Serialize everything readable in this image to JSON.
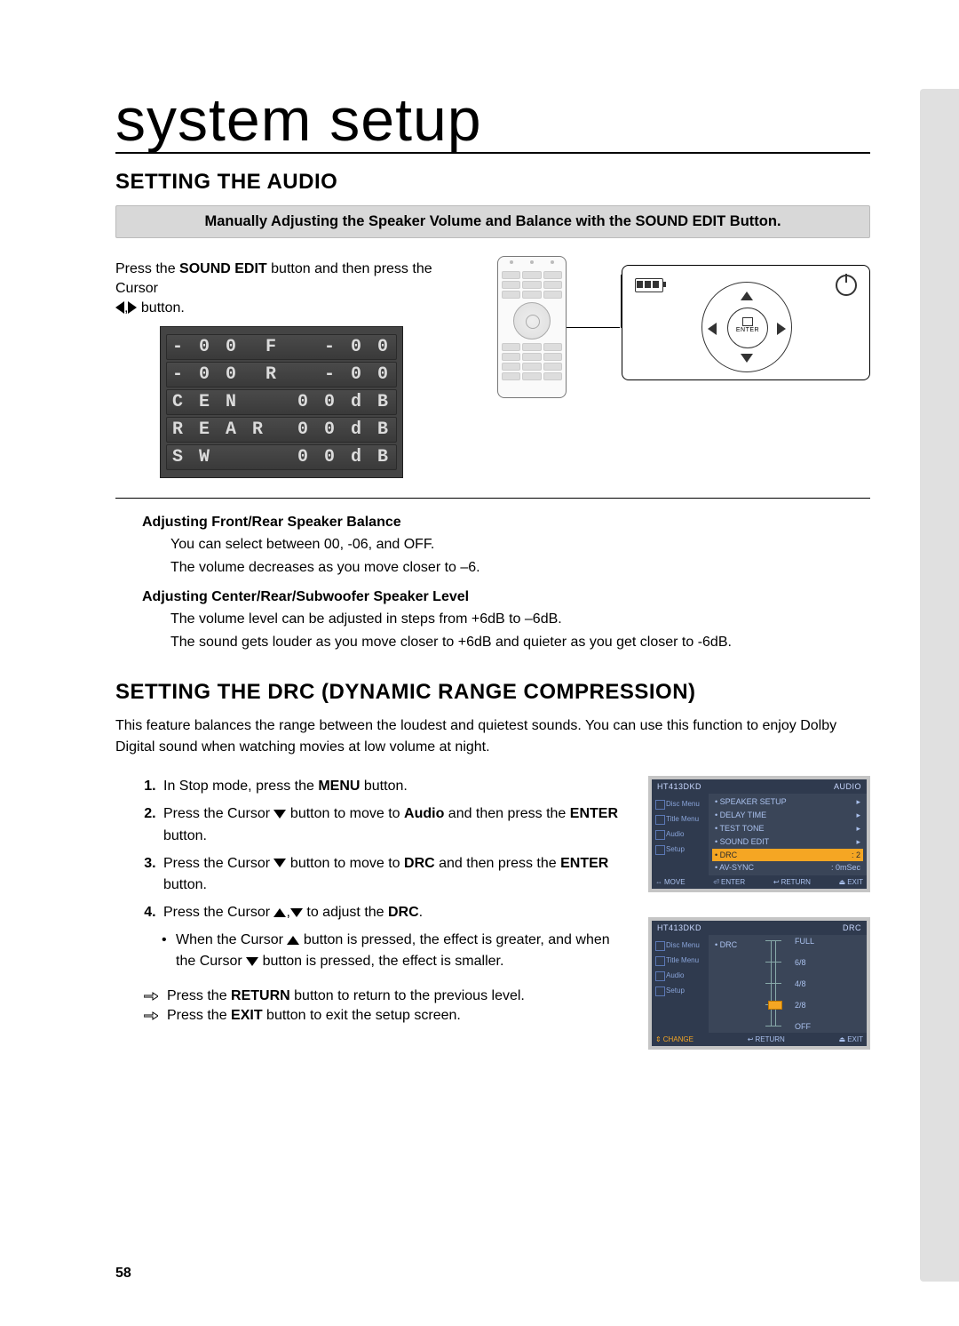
{
  "page_title": "system setup",
  "section1": {
    "heading": "SETTING THE AUDIO",
    "banner": "Manually Adjusting the Speaker Volume and Balance with the SOUND EDIT Button.",
    "intro_pre": "Press the ",
    "intro_bold": "SOUND EDIT",
    "intro_post": " button and then press the Cursor ",
    "intro_tail": " button.",
    "enter_label": "ENTER",
    "lcd_rows": [
      {
        "left": "- 0 0  F",
        "right": "- 0 0"
      },
      {
        "left": "- 0 0  R",
        "right": "- 0 0"
      },
      {
        "left": "C E N",
        "right": "0 0 d B"
      },
      {
        "left": "R E A R",
        "right": "0 0 d B"
      },
      {
        "left": "S W",
        "right": "0 0 d B"
      }
    ],
    "sub1_title": "Adjusting Front/Rear Speaker Balance",
    "sub1_line1": "You can select between 00, -06, and OFF.",
    "sub1_line2": "The volume decreases as you move closer to –6.",
    "sub2_title": "Adjusting Center/Rear/Subwoofer Speaker Level",
    "sub2_line1": "The volume level can be adjusted in steps from +6dB to –6dB.",
    "sub2_line2": "The sound gets louder as you move closer to +6dB and quieter as you get closer to -6dB."
  },
  "section2": {
    "heading": "SETTING THE DRC (DYNAMIC RANGE COMPRESSION)",
    "intro": "This feature balances the range between the loudest and quietest sounds. You can use this function to enjoy Dolby Digital sound when watching movies at low volume at night.",
    "step1_pre": "In Stop mode, press the ",
    "step1_bold": "MENU",
    "step1_post": " button.",
    "step2_a": "Press the Cursor ",
    "step2_b": " button to move to ",
    "step2_bold1": "Audio",
    "step2_c": " and then press the ",
    "step2_bold2": "ENTER",
    "step2_d": " button.",
    "step3_a": "Press the Cursor ",
    "step3_b": " button to move to ",
    "step3_bold1": "DRC",
    "step3_c": " and then press the ",
    "step3_bold2": "ENTER",
    "step3_d": " button.",
    "step4_a": "Press the Cursor ",
    "step4_b": " to adjust the ",
    "step4_bold": "DRC",
    "step4_c": ".",
    "bullet_a": "When the Cursor ",
    "bullet_b": " button is pressed, the effect is greater, and when the Cursor ",
    "bullet_c": " button is pressed, the effect is smaller.",
    "note1_a": "Press the ",
    "note1_bold": "RETURN",
    "note1_b": " button to return to the previous level.",
    "note2_a": "Press the ",
    "note2_bold": "EXIT",
    "note2_b": " button to exit the setup screen."
  },
  "osd1": {
    "breadcrumb": "HT413DKD",
    "tab": "AUDIO",
    "side": [
      "Disc Menu",
      "Title Menu",
      "Audio",
      "Setup"
    ],
    "items": [
      {
        "label": "SPEAKER SETUP",
        "val": "",
        "sel": false
      },
      {
        "label": "DELAY TIME",
        "val": "",
        "sel": false
      },
      {
        "label": "TEST TONE",
        "val": "",
        "sel": false
      },
      {
        "label": "SOUND EDIT",
        "val": "",
        "sel": false
      },
      {
        "label": "DRC",
        "val": ": 2",
        "sel": true
      },
      {
        "label": "AV-SYNC",
        "val": ": 0mSec",
        "sel": false
      }
    ],
    "foot": [
      "MOVE",
      "ENTER",
      "RETURN",
      "EXIT"
    ]
  },
  "osd2": {
    "breadcrumb": "HT413DKD",
    "tab": "DRC",
    "side": [
      "Disc Menu",
      "Title Menu",
      "Audio",
      "Setup"
    ],
    "item_label": "DRC",
    "scale": [
      "FULL",
      "6/8",
      "4/8",
      "2/8",
      "OFF"
    ],
    "selected_index": 3,
    "foot": [
      "CHANGE",
      "RETURN",
      "EXIT"
    ]
  },
  "page_number": "58"
}
